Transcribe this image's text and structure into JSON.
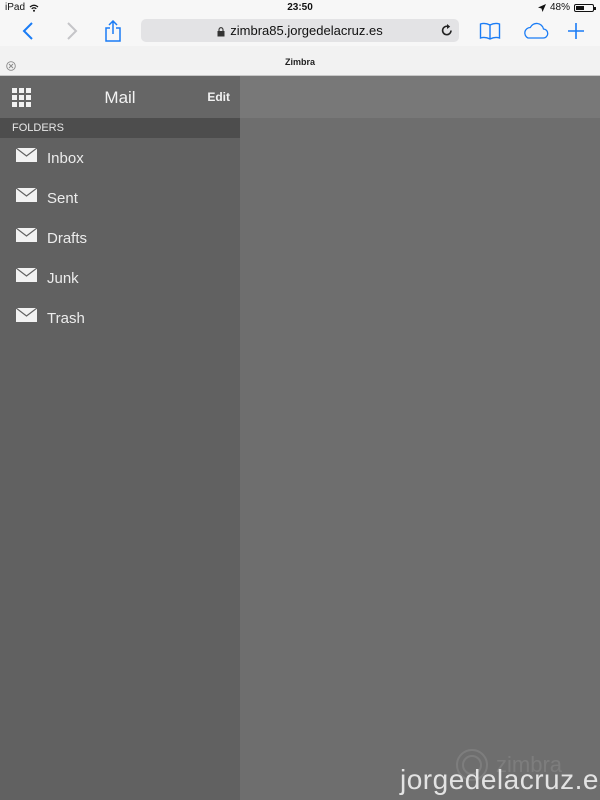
{
  "status_bar": {
    "device": "iPad",
    "time": "23:50",
    "battery": "48%",
    "battery_level": 0.48
  },
  "browser": {
    "url": "zimbra85.jorgedelacruz.es",
    "tab_title": "Zimbra",
    "accent_color": "#1a7cf5"
  },
  "sidebar": {
    "title": "Mail",
    "edit_label": "Edit",
    "section_header": "FOLDERS",
    "folders": [
      {
        "label": "Inbox",
        "icon": "envelope-icon"
      },
      {
        "label": "Sent",
        "icon": "envelope-icon"
      },
      {
        "label": "Drafts",
        "icon": "envelope-icon"
      },
      {
        "label": "Junk",
        "icon": "envelope-icon"
      },
      {
        "label": "Trash",
        "icon": "envelope-icon"
      }
    ]
  },
  "watermark": {
    "logo_text": "zimbra",
    "site": "jorgedelacruz.es"
  }
}
